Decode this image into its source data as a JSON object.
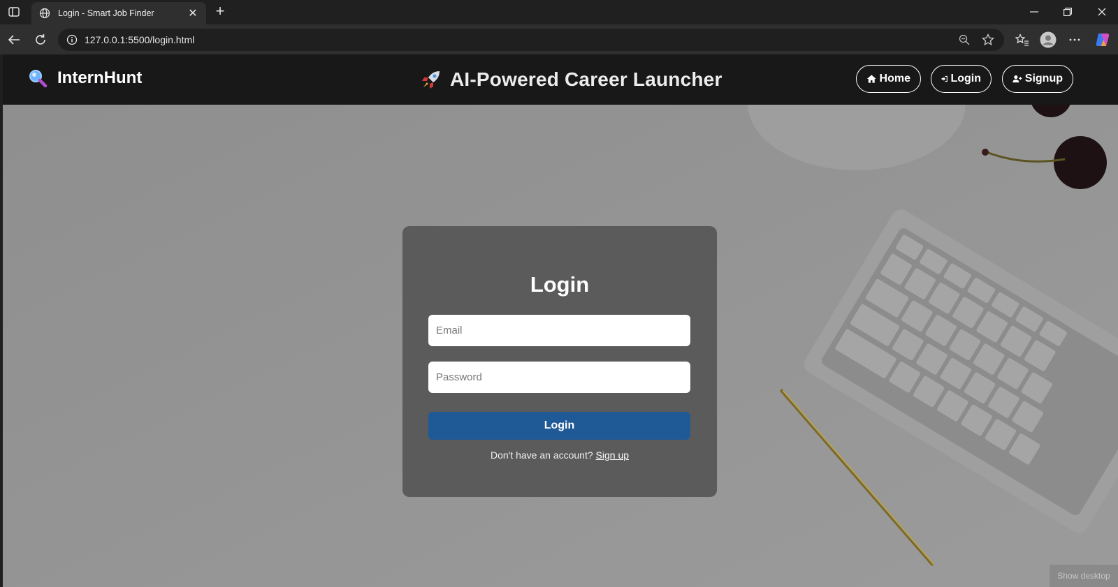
{
  "browser": {
    "tab_title": "Login - Smart Job Finder",
    "url": "127.0.0.1:5500/login.html"
  },
  "navbar": {
    "brand": "InternHunt",
    "tagline": "AI-Powered Career Launcher",
    "links": {
      "home": "Home",
      "login": "Login",
      "signup": "Signup"
    }
  },
  "login_form": {
    "title": "Login",
    "email_placeholder": "Email",
    "password_placeholder": "Password",
    "submit_label": "Login",
    "signup_prompt": "Don't have an account?",
    "signup_link": "Sign up"
  },
  "taskbar_tip": "Show desktop",
  "colors": {
    "navbar_bg": "#181818",
    "card_bg": "#5b5b5b",
    "primary_button": "#1f5a96"
  },
  "icons": {
    "brand": "magnifier-icon",
    "tagline": "rocket-icon",
    "home": "house-icon",
    "login": "sign-in-icon",
    "signup": "user-plus-icon"
  }
}
